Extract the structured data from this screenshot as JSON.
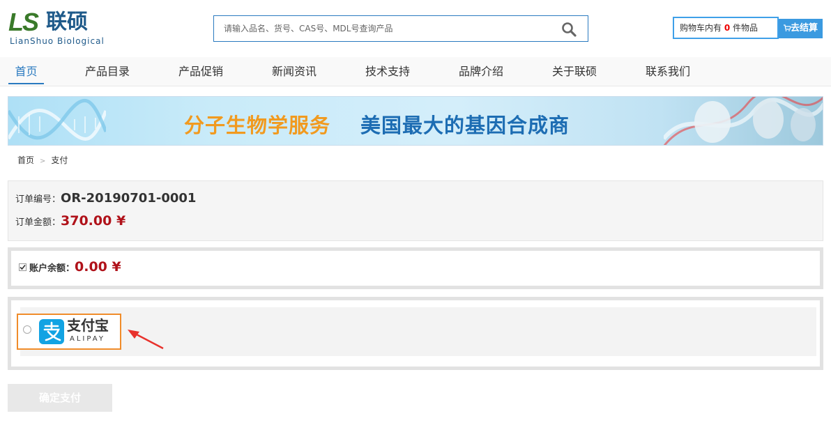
{
  "header": {
    "logo_mark": "LS",
    "logo_cn": "联硕",
    "logo_en": "LianShuo Biological",
    "search_placeholder": "请输入品名、货号、CAS号、MDL号查询产品",
    "cart_prefix": "购物车内有 ",
    "cart_count": "0",
    "cart_suffix": " 件物品",
    "checkout_label": "去结算"
  },
  "nav": {
    "items": [
      "首页",
      "产品目录",
      "产品促销",
      "新闻资讯",
      "技术支持",
      "品牌介绍",
      "关于联硕",
      "联系我们"
    ],
    "active_index": 0
  },
  "banner": {
    "text_orange": "分子生物学服务",
    "text_blue": "美国最大的基因合成商"
  },
  "breadcrumb": {
    "home": "首页",
    "separator": ">",
    "current": "支付"
  },
  "order": {
    "number_label": "订单编号：",
    "number_value": "OR-20190701-0001",
    "amount_label": "订单金额：",
    "amount_value": "370.00 ¥"
  },
  "balance": {
    "label": "账户余额：",
    "value": "0.00 ¥",
    "checked": true
  },
  "payment": {
    "method_cn": "支付宝",
    "method_en": "ALIPAY",
    "selected": false
  },
  "confirm_label": "确定支付",
  "colors": {
    "brand_blue": "#2a7ac0",
    "amount_red": "#b0121a",
    "highlight_orange": "#f08c2a",
    "alipay_blue": "#12a3e3"
  }
}
